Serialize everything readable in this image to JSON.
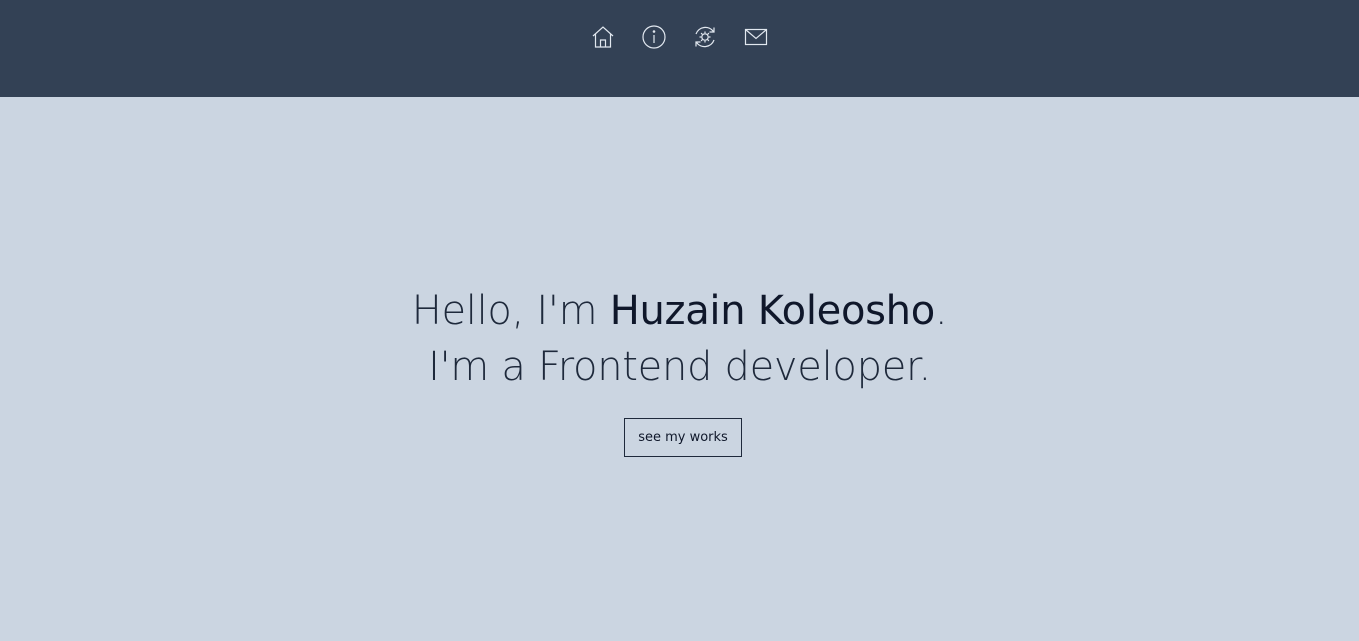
{
  "nav": {
    "items": [
      {
        "icon": "home-icon"
      },
      {
        "icon": "info-icon"
      },
      {
        "icon": "gear-refresh-icon"
      },
      {
        "icon": "mail-icon"
      }
    ]
  },
  "hero": {
    "line1_prefix": "Hello, I'm ",
    "name": "Huzain Koleosho",
    "line1_suffix": ".",
    "line2": "I'm a Frontend developer.",
    "button_label": "see my works"
  },
  "colors": {
    "topbar": "#334155",
    "background": "#cbd5e1",
    "text": "#1e293b",
    "icon": "#e2e8f0"
  }
}
